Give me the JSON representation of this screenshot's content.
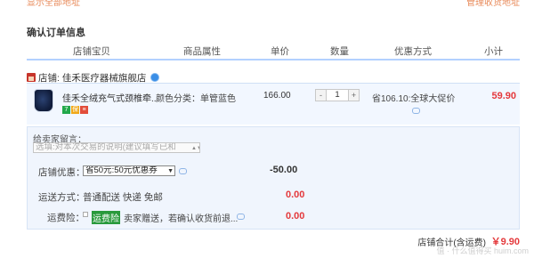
{
  "top_links": {
    "left": "显示全部地址",
    "right": "管理收货地址"
  },
  "section_title": "确认订单信息",
  "columns": [
    "店铺宝贝",
    "商品属性",
    "单价",
    "数量",
    "优惠方式",
    "小计"
  ],
  "shop": {
    "label": "店铺: 佳禾医疗器械旗舰店"
  },
  "item": {
    "title": "佳禾全绒充气式颈椎牵...",
    "attribute": "颜色分类：单管蓝色",
    "price": "166.00",
    "quantity": "1",
    "qty_minus": "-",
    "qty_plus": "+",
    "discount": "省106.10:全球大促价",
    "subtotal": "59.90",
    "badges": [
      {
        "text": "7",
        "color": "#22a84a"
      },
      {
        "text": "保",
        "color": "#f0a818"
      },
      {
        "text": "≡",
        "color": "#e24d3a"
      }
    ]
  },
  "message": {
    "label": "给卖家留言：",
    "placeholder": "选填:对本次交易的说明(建议填写已和"
  },
  "shop_discount": {
    "label": "店铺优惠：",
    "selected": "省50元:50元优惠券",
    "value": "-50.00"
  },
  "shipping": {
    "label": "运送方式：",
    "method": "普通配送 快递 免邮",
    "value": "0.00"
  },
  "insurance": {
    "label": "运费险：",
    "tag": "运费险",
    "text": "卖家赠送，若确认收货前退...",
    "value": "0.00"
  },
  "total": {
    "label": "店铺合计(含运费)",
    "value": "￥9.90"
  },
  "watermark": "值 · 什么值得买 huim.com",
  "colors": {
    "price_red": "#e4393c",
    "panel_bg": "#f0f5fd",
    "row_bg": "#f2f7ff",
    "header_line": "#b2d1ff",
    "link_orange": "#e88a5a"
  }
}
